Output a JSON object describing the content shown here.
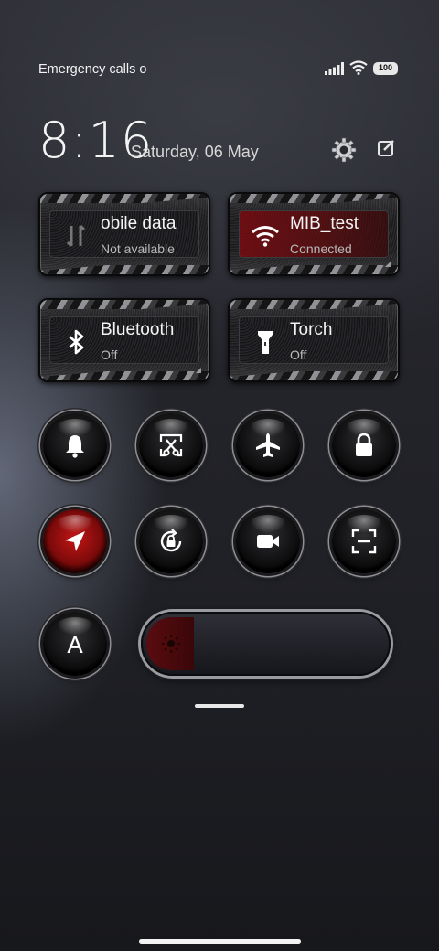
{
  "status_bar": {
    "carrier_text": "Emergency calls o",
    "battery": "100",
    "icons": [
      "signal-icon",
      "wifi-icon",
      "battery-icon"
    ]
  },
  "header": {
    "time": "8:16",
    "date": "Saturday, 06 May",
    "icons": [
      "gear-icon",
      "edit-icon"
    ]
  },
  "tiles": [
    {
      "title": "obile data",
      "subtitle": "Not available",
      "icon": "mobile-data-icon",
      "active": false
    },
    {
      "title": "MIB_test",
      "subtitle": "Connected",
      "icon": "wifi-icon",
      "active": true
    },
    {
      "title": "Bluetooth",
      "subtitle": "Off",
      "icon": "bluetooth-icon",
      "active": false
    },
    {
      "title": "Torch",
      "subtitle": "Off",
      "icon": "flashlight-icon",
      "active": false
    }
  ],
  "toggles": [
    {
      "icon": "bell-icon",
      "active": false
    },
    {
      "icon": "screenshot-icon",
      "active": false
    },
    {
      "icon": "airplane-icon",
      "active": false
    },
    {
      "icon": "lock-icon",
      "active": false
    },
    {
      "icon": "location-icon",
      "active": true
    },
    {
      "icon": "rotation-lock-icon",
      "active": false
    },
    {
      "icon": "video-camera-icon",
      "active": false
    },
    {
      "icon": "scan-icon",
      "active": false
    },
    {
      "icon": "auto-brightness-icon",
      "label": "A",
      "active": false
    }
  ],
  "brightness": {
    "level": 0.2,
    "icon": "sun-icon"
  },
  "colors": {
    "accent_red": "#b01010",
    "active_tile": "#6e1418"
  }
}
